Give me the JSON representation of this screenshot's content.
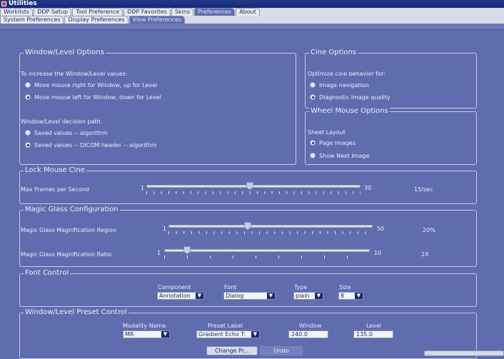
{
  "window": {
    "title": "Utilities"
  },
  "tabs_main": [
    "Worklists",
    "DDP Setup",
    "Tool Preference",
    "DDP Favorites",
    "Skins",
    "Preferences",
    "About"
  ],
  "tabs_sub": [
    "System Preferences",
    "Display Preferences",
    "View Preferences"
  ],
  "window_level": {
    "title": "Window/Level Options",
    "increase_label": "To increase the Window/Level values:",
    "options": [
      "Move mouse right for Window, up for Level",
      "Move mouse left for Window, down for Level"
    ],
    "selected_option": 1,
    "decision_label": "Window/Level decision path:",
    "decision_options": [
      "Saved values -- algorithm",
      "Saved values -- DICOM header -- algorithm"
    ],
    "selected_decision": 1
  },
  "cine": {
    "title": "Cine Options",
    "optimize_label": "Optimize cine behavior for:",
    "options": [
      "Image navigation",
      "Diagnostic image quality"
    ],
    "selected": 1
  },
  "wheel": {
    "title": "Wheel Mouse Options",
    "sheet_label": "Sheet Layout",
    "options": [
      "Page Images",
      "Show Next Image"
    ],
    "selected": 0
  },
  "lock_cine": {
    "title": "Lock Mouse Cine",
    "label": "Max Frames per Second",
    "min": "1",
    "max": "30",
    "value": 15,
    "value_text": "15/sec"
  },
  "magic_glass": {
    "title": "Magic Glass Configuration",
    "region_label": "Magic Glass Magnification Region",
    "region_min": "1",
    "region_max": "50",
    "region_value": 20,
    "region_value_text": "20%",
    "ratio_label": "Magic Glass Magnification Ratio",
    "ratio_min": "1",
    "ratio_max": "10",
    "ratio_value": 2,
    "ratio_value_text": "2X"
  },
  "font": {
    "title": "Font Control",
    "component_label": "Component",
    "component_value": "Annotation",
    "font_label": "Font",
    "font_value": "Dialog",
    "type_label": "Type",
    "type_value": "plain",
    "size_label": "Size",
    "size_value": "8"
  },
  "preset": {
    "title": "Window/Level Preset Control",
    "modality_label": "Modality Name",
    "modality_value": "MR",
    "preset_label": "Preset Label",
    "preset_value": "Gradient Echo T:",
    "window_label": "Window",
    "window_value": "240.0",
    "level_label": "Level",
    "level_value": "135.0",
    "change_button": "Change Pr...",
    "undo_button": "Undo"
  },
  "icons": {
    "app": "utilities-icon",
    "dropdown": "chevron-down-icon"
  }
}
